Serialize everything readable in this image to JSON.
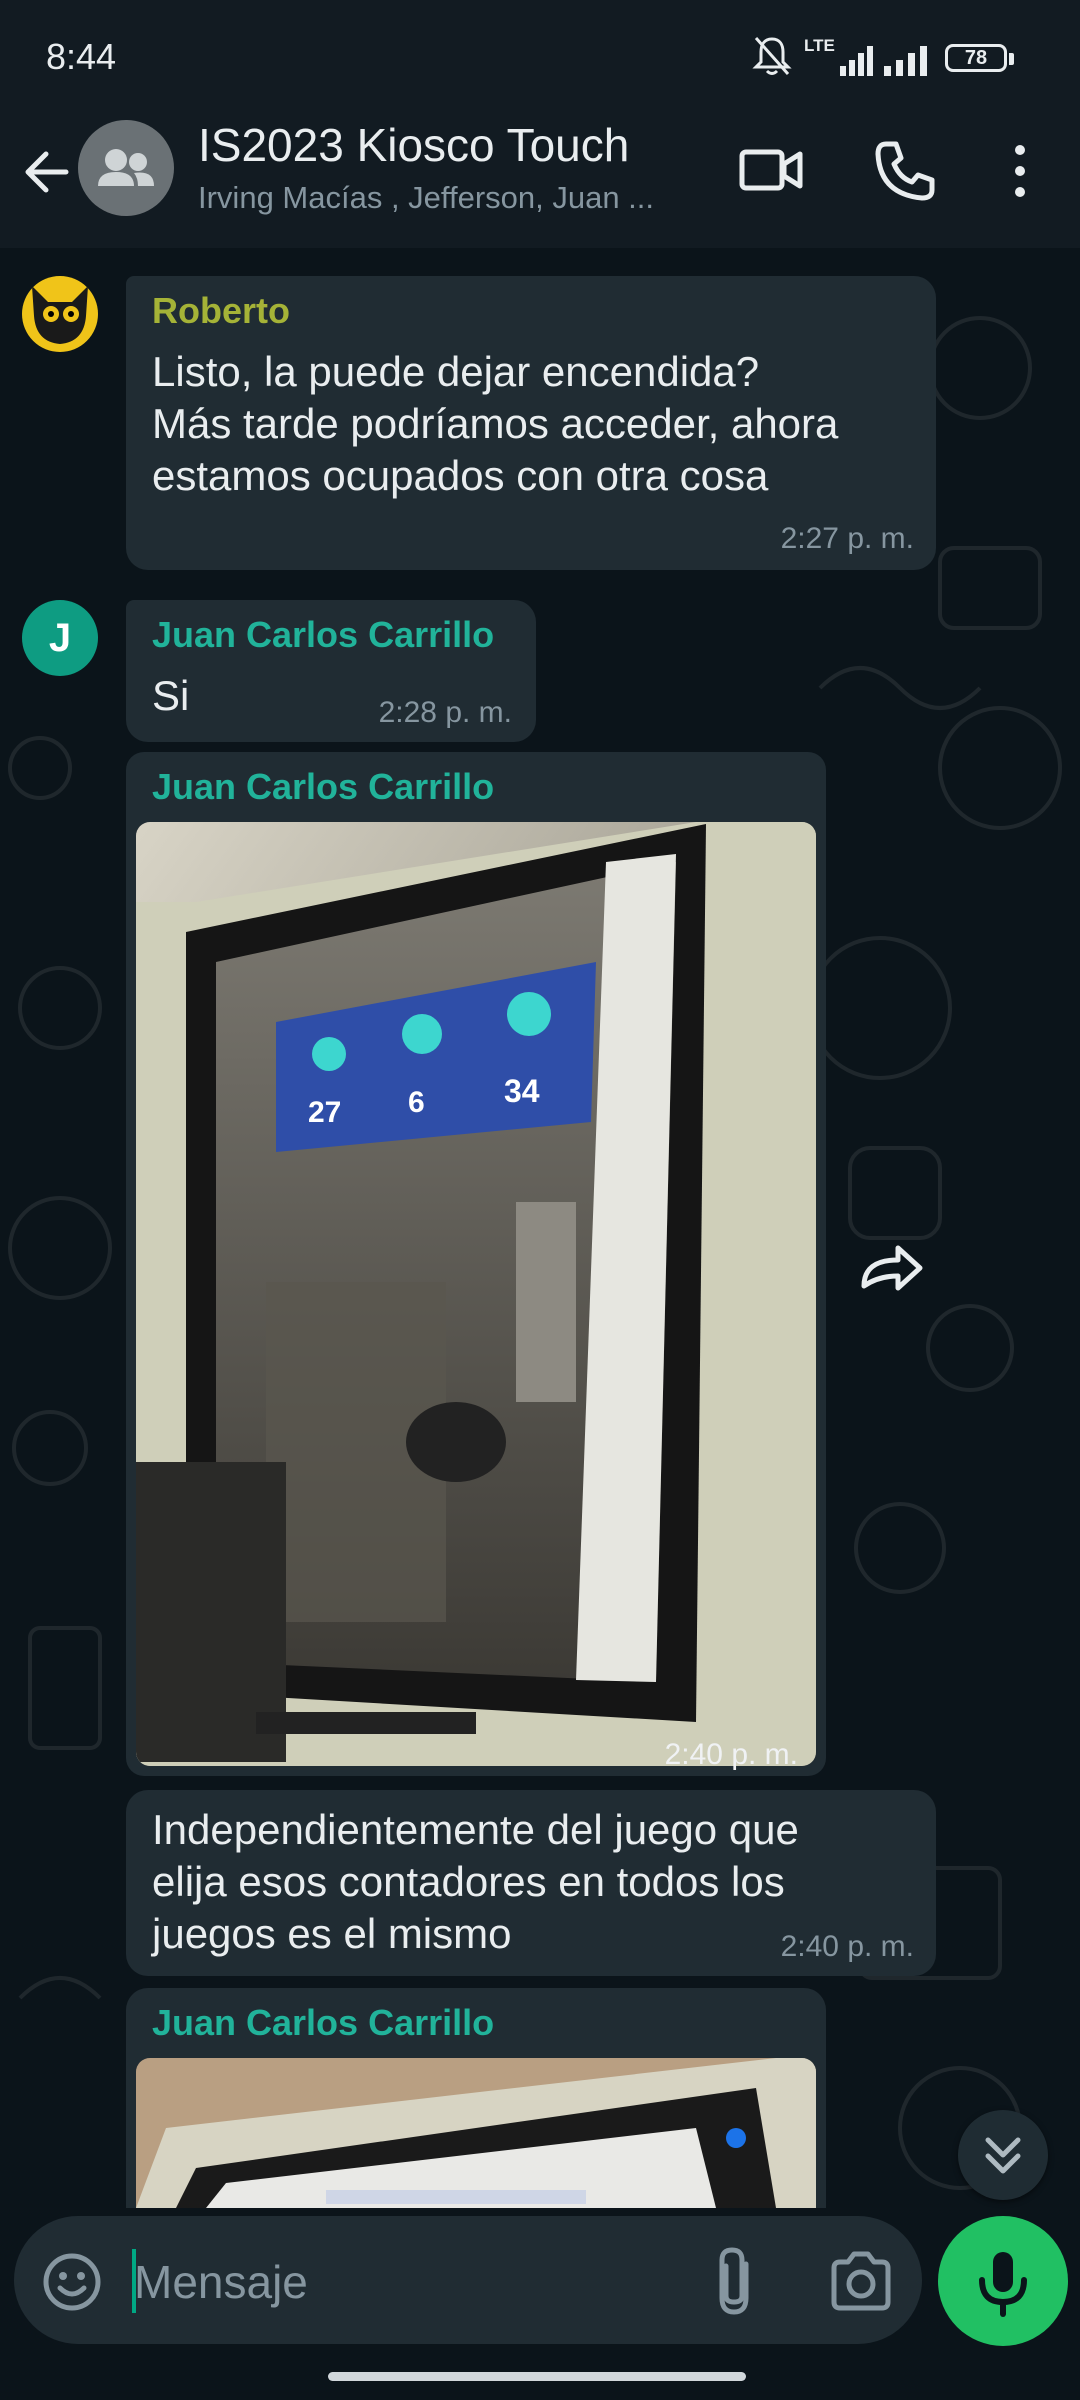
{
  "status_bar": {
    "time": "8:44",
    "network_label": "LTE",
    "battery": "78",
    "icons": [
      "mute-bell-icon",
      "signal-icon",
      "signal-icon",
      "battery-icon"
    ]
  },
  "header": {
    "title": "IS2023 Kiosco Touch",
    "members": "Irving Macías , Jefferson, Juan ...",
    "icons": [
      "back-arrow-icon",
      "group-avatar-icon",
      "video-call-icon",
      "phone-icon",
      "more-vert-icon"
    ]
  },
  "messages": [
    {
      "sender": "Roberto",
      "sender_color": "#a5b337",
      "text": "Listo, la puede dejar encendida?\nMás tarde podríamos acceder, ahora estamos ocupados con otra cosa",
      "time": "2:27 p. m."
    },
    {
      "sender": "Juan Carlos Carrillo",
      "sender_color": "#21b39a",
      "avatar_initial": "J",
      "text": "Si",
      "time": "2:28 p. m."
    },
    {
      "sender": "Juan Carlos Carrillo",
      "type": "image",
      "photo_values": [
        "27",
        "6",
        "34"
      ],
      "time": "2:40 p. m."
    },
    {
      "text": "Independientemente del juego que elija esos contadores en todos los juegos es el mismo",
      "time": "2:40 p. m."
    },
    {
      "sender": "Juan Carlos Carrillo",
      "type": "image"
    }
  ],
  "composer": {
    "placeholder": "Mensaje",
    "icons": [
      "emoji-icon",
      "attach-icon",
      "camera-icon",
      "mic-icon"
    ]
  },
  "colors": {
    "background": "#0b141a",
    "bubble": "#202c33",
    "accent": "#21c063"
  }
}
